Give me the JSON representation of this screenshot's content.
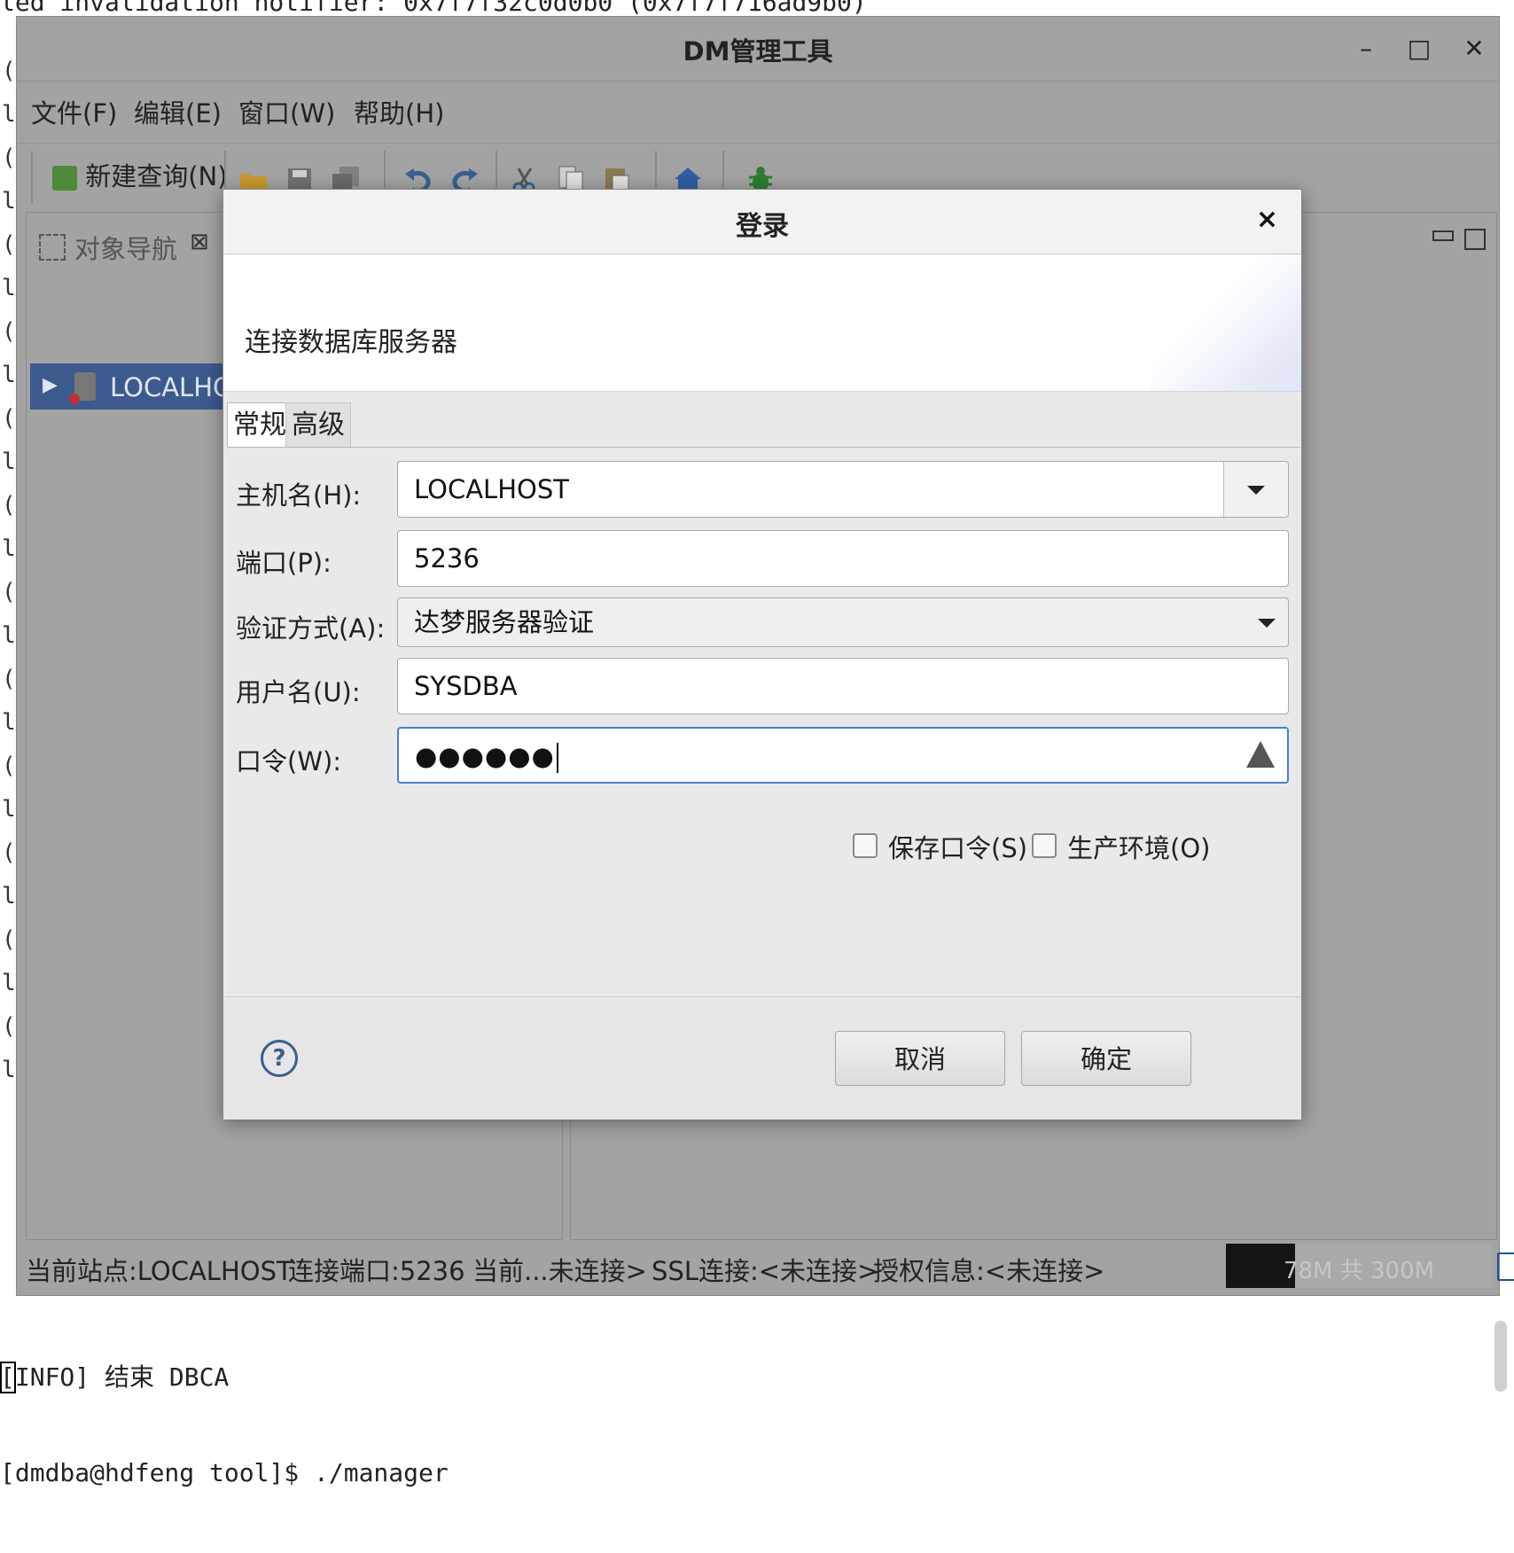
{
  "terminal": {
    "top_line": "led invalidation notifier: 0x7f7f32c0d0b0 (0x7f7f716ad9b0)",
    "gutter_chars": [
      "(",
      "l",
      "(",
      "l",
      "(",
      "l",
      "(",
      "l",
      "(",
      "l",
      "(",
      "l",
      "(",
      "l",
      "(",
      "l",
      "(",
      "l",
      "(",
      "l",
      "(",
      "l",
      "(",
      "l",
      "(",
      "l",
      "(",
      "l",
      "(",
      "l",
      "(",
      "l",
      "(",
      "l",
      "(",
      "l",
      "(",
      "l",
      "(",
      "l",
      "(",
      "l",
      "(",
      "l",
      "(",
      "l",
      "2"
    ],
    "info_line": "[INFO] 结束 DBCA",
    "prompt_line": "[dmdba@hdfeng tool]$ ./manager"
  },
  "window": {
    "title": "DM管理工具",
    "controls": {
      "minimize": "–",
      "maximize": "□",
      "close": "✕"
    }
  },
  "menubar": [
    "文件(F)",
    "编辑(E)",
    "窗口(W)",
    "帮助(H)"
  ],
  "toolbar": {
    "new_query": "新建查询(N)",
    "icons": [
      "open-folder-icon",
      "save-icon",
      "save-all-icon",
      "undo-icon",
      "redo-icon",
      "cut-icon",
      "copy-icon",
      "paste-icon",
      "home-icon",
      "debug-icon"
    ]
  },
  "navigator": {
    "tab_label": "对象导航",
    "tree": [
      {
        "label": "LOCALHO"
      }
    ]
  },
  "dialog": {
    "title": "登录",
    "close": "×",
    "banner_text": "连接数据库服务器",
    "tabs": [
      "常规",
      "高级"
    ],
    "fields": {
      "host_label": "主机名(H):",
      "host_value": "LOCALHOST",
      "port_label": "端口(P):",
      "port_value": "5236",
      "auth_label": "验证方式(A):",
      "auth_value": "达梦服务器验证",
      "user_label": "用户名(U):",
      "user_value": "SYSDBA",
      "password_label": "口令(W):",
      "password_mask": "●●●●●●"
    },
    "checkboxes": {
      "save_password": "保存口令(S)",
      "production_env": "生产环境(O)"
    },
    "buttons": {
      "help": "?",
      "cancel": "取消",
      "ok": "确定"
    }
  },
  "statusbar": {
    "site": "当前站点:LOCALHOST",
    "port": "连接端口:5236",
    "current": "当前...未连接>",
    "ssl": "SSL连接:<未连接>",
    "license": "授权信息:<未连接>",
    "memory": "78M 共 300M",
    "memory_fraction": 0.26
  }
}
